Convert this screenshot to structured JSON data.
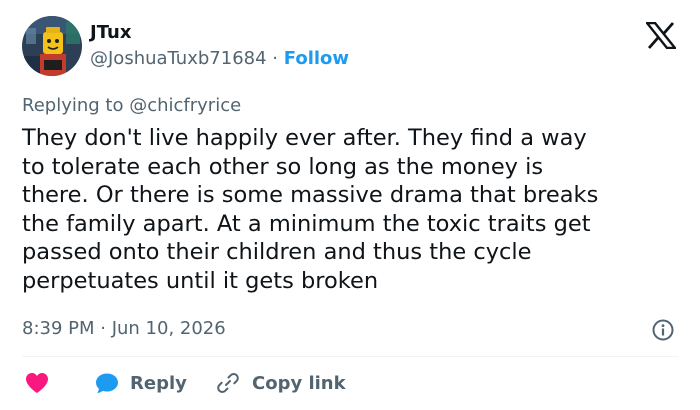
{
  "author": {
    "display_name": "JTux",
    "handle": "@JoshuaTuxb71684",
    "separator": "·",
    "follow_label": "Follow"
  },
  "reply_context": {
    "prefix": "Replying to",
    "target": "@chicfryrice"
  },
  "tweet": {
    "lines": [
      "They don't live happily ever after. They find a way",
      "to tolerate each other so long as the money is",
      "there. Or there is some massive drama that breaks",
      "the family apart. At a minimum the toxic traits get",
      "passed onto their children and thus the cycle",
      "perpetuates until it gets broken"
    ],
    "timestamp": "8:39 PM · Jun 10, 2026"
  },
  "actions": {
    "reply_label": "Reply",
    "copy_link_label": "Copy link"
  },
  "icons": {
    "logo": "x-logo-icon",
    "avatar": "lego-minifig-avatar",
    "info": "info-icon",
    "like": "heart-icon",
    "reply": "speech-bubble-icon",
    "copy": "link-icon"
  },
  "colors": {
    "text": "#0f1419",
    "muted": "#536471",
    "link": "#1d9bf0",
    "heart": "#f91880",
    "divider": "#eff3f4"
  }
}
